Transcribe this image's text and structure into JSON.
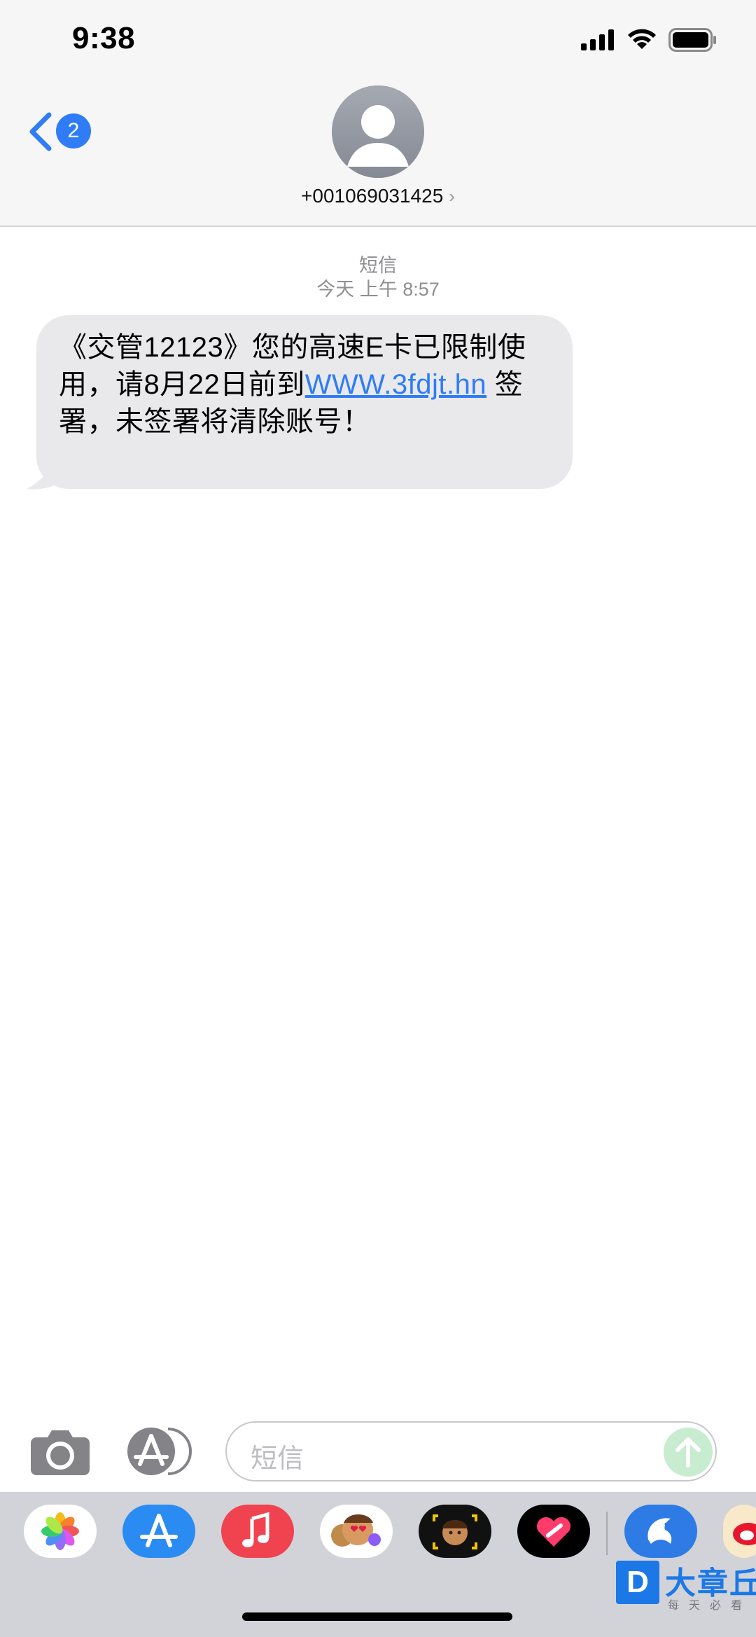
{
  "status_bar": {
    "time": "9:38"
  },
  "header": {
    "back_badge": "2",
    "contact": "+001069031425",
    "contact_chevron": "›"
  },
  "conversation": {
    "service_label": "短信",
    "timestamp": "今天 上午 8:57",
    "message": {
      "part1": "《交管12123》您的高速E卡已限制使用，请8月22日前到",
      "link": "WWW.3fdjt.hn",
      "part2": " 签署，未签署将清除账号！"
    }
  },
  "input_bar": {
    "placeholder": "短信",
    "camera_icon": "camera-icon",
    "appstore_icon": "app-store-icon",
    "send_icon": "send-arrow-icon"
  },
  "app_drawer": {
    "apps": [
      "photos",
      "app-store",
      "music",
      "memoji-stickers",
      "animoji",
      "heart-digital-touch",
      "dolphin-app",
      "weibo"
    ]
  },
  "watermark": {
    "badge": "D",
    "title": "大章丘",
    "subtitle": "每天必看"
  },
  "colors": {
    "accent": "#2f7cf6",
    "bubble": "#e9e9eb",
    "header_bg": "#f6f6f6",
    "drawer_bg": "#d1d3d9"
  }
}
